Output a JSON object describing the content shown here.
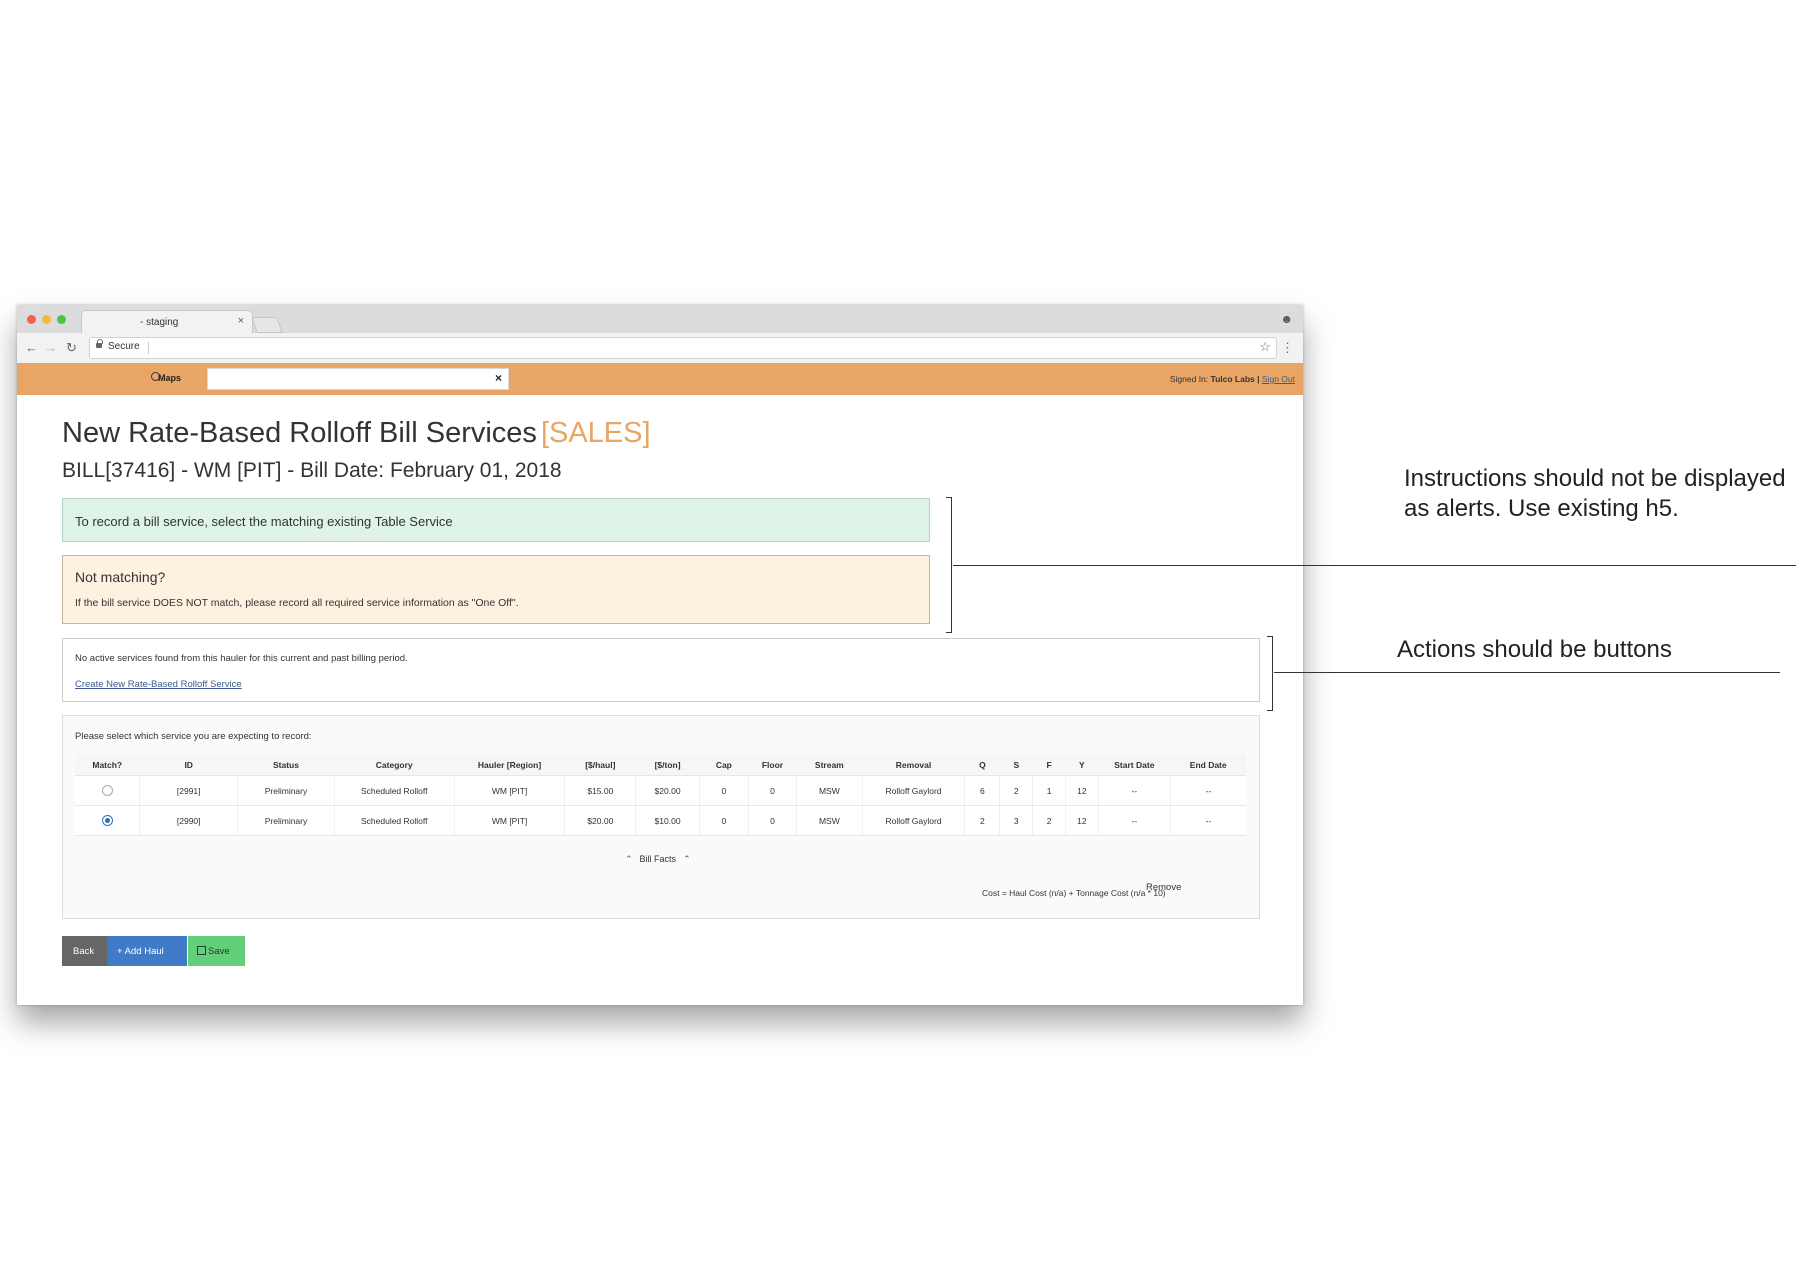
{
  "browser": {
    "tab_title": "- staging",
    "tab_close": "×",
    "secure_label": "Secure",
    "address": "",
    "nav_back": "←",
    "nav_forward": "→",
    "nav_reload": "↻",
    "star": "☆",
    "menu": "⋮",
    "profile": "☻"
  },
  "navbar": {
    "maps_label": "Maps",
    "search_value": "",
    "clear_icon": "×",
    "signed_in_prefix": "Signed In:",
    "user_name": "Tulco Labs",
    "separator": "|",
    "sign_out": "Sign Out",
    "bar_color": "#e8a566"
  },
  "page": {
    "title": "New Rate-Based Rolloff Bill Services",
    "title_tag": "[SALES]",
    "subtitle": "BILL[37416] - WM [PIT] - Bill Date: February 01, 2018"
  },
  "alerts": {
    "success_text": "To record a bill service, select the matching existing Table Service",
    "warning_title": "Not matching?",
    "warning_body": "If the bill service DOES NOT match, please record all required service information as \"One Off\"."
  },
  "no_active": {
    "message": "No active services found from this hauler for this current and past billing period.",
    "link": "Create New Rate-Based Rolloff Service"
  },
  "services": {
    "prompt": "Please select which service you are expecting to record:",
    "columns": [
      "Match?",
      "ID",
      "Status",
      "Category",
      "Hauler [Region]",
      "[$/haul]",
      "[$/ton]",
      "Cap",
      "Floor",
      "Stream",
      "Removal",
      "Q",
      "S",
      "F",
      "Y",
      "Start Date",
      "End Date"
    ],
    "rows": [
      {
        "selected": false,
        "id": "[2991]",
        "status": "Preliminary",
        "category": "Scheduled Rolloff",
        "hauler": "WM [PIT]",
        "haul": "$15.00",
        "ton": "$20.00",
        "cap": "0",
        "floor": "0",
        "stream": "MSW",
        "removal": "Rolloff Gaylord",
        "q": "6",
        "s": "2",
        "f": "1",
        "y": "12",
        "start": "--",
        "end": "--"
      },
      {
        "selected": true,
        "id": "[2990]",
        "status": "Preliminary",
        "category": "Scheduled Rolloff",
        "hauler": "WM [PIT]",
        "haul": "$20.00",
        "ton": "$10.00",
        "cap": "0",
        "floor": "0",
        "stream": "MSW",
        "removal": "Rolloff Gaylord",
        "q": "2",
        "s": "3",
        "f": "2",
        "y": "12",
        "start": "--",
        "end": "--"
      }
    ],
    "bill_facts": "Bill Facts",
    "bill_facts_caret": "⌃",
    "remove": "Remove",
    "cost_formula": "Cost = Haul Cost (n/a) + Tonnage Cost (n/a * 10)"
  },
  "actions": {
    "back": "Back",
    "add_haul": "+ Add Haul",
    "save": "Save"
  },
  "annotations": {
    "note_1": "Instructions should not be displayed as alerts. Use existing h5.",
    "note_2": "Actions should be buttons"
  }
}
